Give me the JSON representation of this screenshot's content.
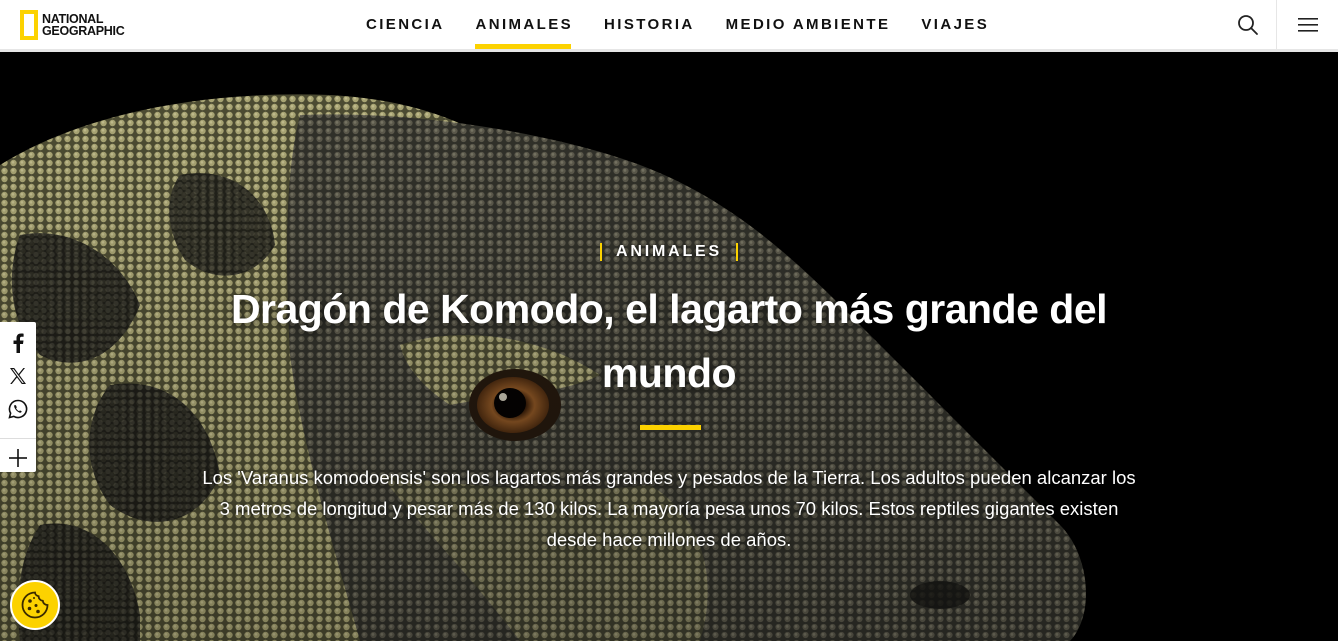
{
  "header": {
    "logo": {
      "line1": "NATIONAL",
      "line2": "GEOGRAPHIC"
    },
    "nav": [
      {
        "label": "CIENCIA",
        "active": false
      },
      {
        "label": "ANIMALES",
        "active": true
      },
      {
        "label": "HISTORIA",
        "active": false
      },
      {
        "label": "MEDIO AMBIENTE",
        "active": false
      },
      {
        "label": "VIAJES",
        "active": false
      }
    ],
    "search_icon": "search-icon",
    "menu_icon": "hamburger-menu-icon"
  },
  "hero": {
    "kicker": "ANIMALES",
    "title": "Dragón de Komodo, el lagarto más grande del mundo",
    "dek": "Los 'Varanus komodoensis' son los lagartos más grandes y pesados de la Tierra. Los adultos pueden alcanzar los 3 metros de longitud y pesar más de 130 kilos. La mayoría pesa unos 70 kilos. Estos reptiles gigantes existen desde hace millones de años."
  },
  "share": {
    "items": [
      "facebook-icon",
      "x-icon",
      "whatsapp-icon",
      "plus-icon"
    ]
  },
  "cookie_button": {
    "icon": "cookie-icon"
  },
  "colors": {
    "accent": "#fcd200",
    "header_bg": "#ffffff",
    "hero_bg": "#000000"
  }
}
